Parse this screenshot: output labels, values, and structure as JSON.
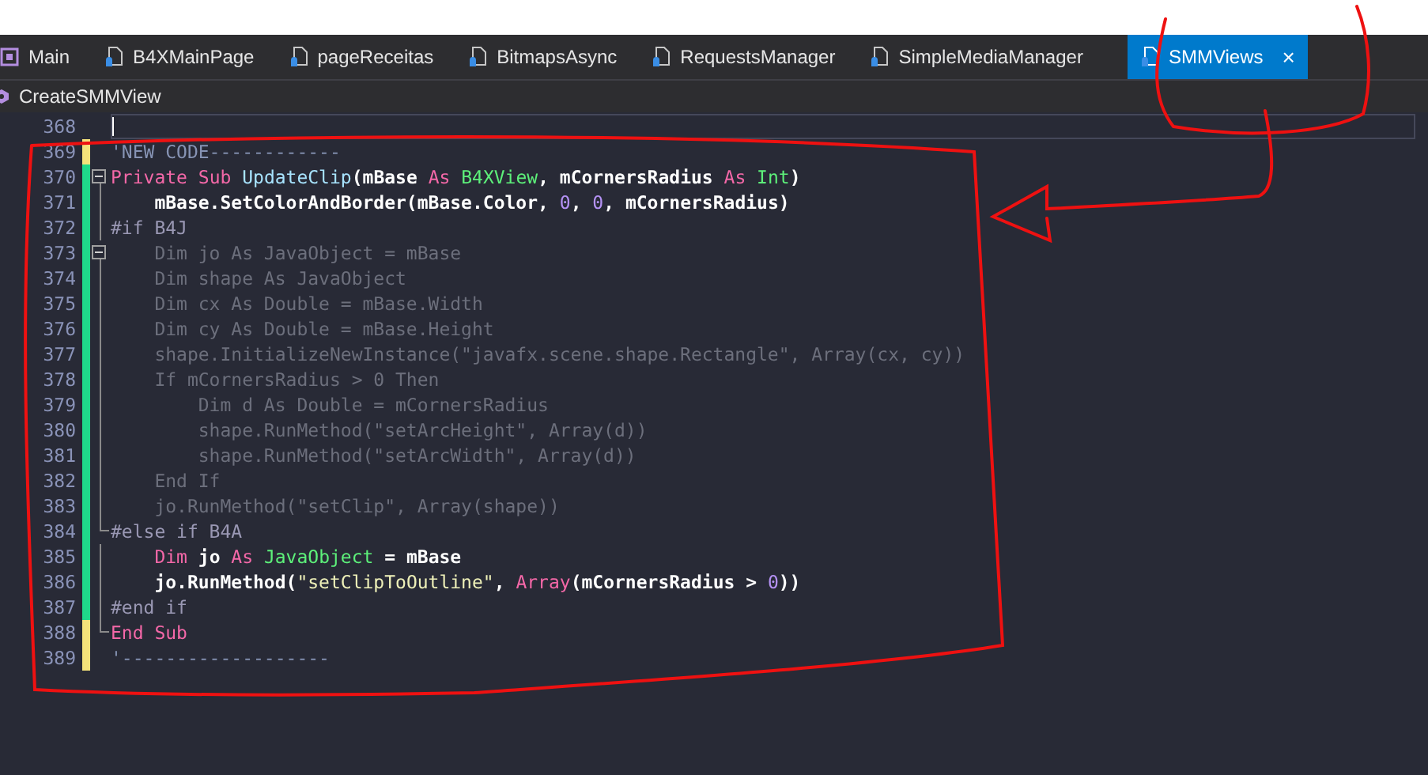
{
  "tabs": [
    {
      "label": "Main",
      "kind": "module",
      "selected": false
    },
    {
      "label": "B4XMainPage",
      "kind": "class",
      "selected": false
    },
    {
      "label": "pageReceitas",
      "kind": "class",
      "selected": false
    },
    {
      "label": "BitmapsAsync",
      "kind": "class",
      "selected": false
    },
    {
      "label": "RequestsManager",
      "kind": "class",
      "selected": false
    },
    {
      "label": "SimpleMediaManager",
      "kind": "class",
      "selected": false
    },
    {
      "label": "SMMViews",
      "kind": "class",
      "selected": true,
      "close": "×"
    }
  ],
  "breadcrumb": {
    "label": "CreateSMMView"
  },
  "lines": [
    {
      "number": "368",
      "kind": "plain",
      "collapsible": false,
      "current": true
    },
    {
      "number": "369",
      "color": "#f4e27a",
      "kind": "plain",
      "collapsible": false,
      "current": false,
      "tokens": [
        {
          "kind": "comment",
          "text": "'NEW CODE------------"
        }
      ]
    },
    {
      "number": "370",
      "color": "#1fd98a",
      "kind": "start",
      "collapsible": true,
      "current": false,
      "tokens": [
        {
          "kind": "keyword",
          "text": "Private"
        },
        {
          "kind": "keyword",
          "text": " Sub"
        },
        {
          "kind": "method",
          "text": " UpdateClip"
        },
        {
          "kind": "ident",
          "text": "(mBase "
        },
        {
          "kind": "keyword",
          "text": "As"
        },
        {
          "kind": "type",
          "text": " B4XView"
        },
        {
          "kind": "ident",
          "text": ", mCornersRadius "
        },
        {
          "kind": "keyword",
          "text": "As"
        },
        {
          "kind": "type",
          "text": " Int"
        },
        {
          "kind": "ident",
          "text": ")"
        }
      ]
    },
    {
      "number": "371",
      "color": "#1fd98a",
      "kind": "inner",
      "collapsible": false,
      "current": false,
      "tokens": [
        {
          "kind": "ident",
          "text": "    mBase.SetColorAndBorder(mBase.Color, "
        },
        {
          "kind": "number",
          "text": "0"
        },
        {
          "kind": "ident",
          "text": ", "
        },
        {
          "kind": "number",
          "text": "0"
        },
        {
          "kind": "ident",
          "text": ", mCornersRadius)"
        }
      ]
    },
    {
      "number": "372",
      "color": "#1fd98a",
      "kind": "inner",
      "collapsible": false,
      "current": false,
      "tokens": [
        {
          "kind": "directive",
          "text": "#if B4J"
        }
      ]
    },
    {
      "number": "373",
      "color": "#1fd98a",
      "kind": "start",
      "collapsible": true,
      "current": false,
      "tokens": [
        {
          "kind": "inactive",
          "text": "    Dim jo As JavaObject = mBase"
        }
      ]
    },
    {
      "number": "374",
      "color": "#1fd98a",
      "kind": "inner",
      "collapsible": false,
      "current": false,
      "tokens": [
        {
          "kind": "inactive",
          "text": "    Dim shape As JavaObject"
        }
      ]
    },
    {
      "number": "375",
      "color": "#1fd98a",
      "kind": "inner",
      "collapsible": false,
      "current": false,
      "tokens": [
        {
          "kind": "inactive",
          "text": "    Dim cx As Double = mBase.Width"
        }
      ]
    },
    {
      "number": "376",
      "color": "#1fd98a",
      "kind": "inner",
      "collapsible": false,
      "current": false,
      "tokens": [
        {
          "kind": "inactive",
          "text": "    Dim cy As Double = mBase.Height"
        }
      ]
    },
    {
      "number": "377",
      "color": "#1fd98a",
      "kind": "inner",
      "collapsible": false,
      "current": false,
      "tokens": [
        {
          "kind": "inactive",
          "text": "    shape.InitializeNewInstance(\"javafx.scene.shape.Rectangle\", Array(cx, cy))"
        }
      ]
    },
    {
      "number": "378",
      "color": "#1fd98a",
      "kind": "inner",
      "collapsible": false,
      "current": false,
      "tokens": [
        {
          "kind": "inactive",
          "text": "    If mCornersRadius > 0 Then"
        }
      ]
    },
    {
      "number": "379",
      "color": "#1fd98a",
      "kind": "inner",
      "collapsible": false,
      "current": false,
      "tokens": [
        {
          "kind": "inactive",
          "text": "        Dim d As Double = mCornersRadius"
        }
      ]
    },
    {
      "number": "380",
      "color": "#1fd98a",
      "kind": "inner",
      "collapsible": false,
      "current": false,
      "tokens": [
        {
          "kind": "inactive",
          "text": "        shape.RunMethod(\"setArcHeight\", Array(d))"
        }
      ]
    },
    {
      "number": "381",
      "color": "#1fd98a",
      "kind": "inner",
      "collapsible": false,
      "current": false,
      "tokens": [
        {
          "kind": "inactive",
          "text": "        shape.RunMethod(\"setArcWidth\", Array(d))"
        }
      ]
    },
    {
      "number": "382",
      "color": "#1fd98a",
      "kind": "inner",
      "collapsible": false,
      "current": false,
      "tokens": [
        {
          "kind": "inactive",
          "text": "    End If"
        }
      ]
    },
    {
      "number": "383",
      "color": "#1fd98a",
      "kind": "inner",
      "collapsible": false,
      "current": false,
      "tokens": [
        {
          "kind": "inactive",
          "text": "    jo.RunMethod(\"setClip\", Array(shape))"
        }
      ]
    },
    {
      "number": "384",
      "color": "#1fd98a",
      "kind": "end",
      "collapsible": false,
      "current": false,
      "tokens": [
        {
          "kind": "directive",
          "text": "#else if B4A"
        }
      ]
    },
    {
      "number": "385",
      "color": "#1fd98a",
      "kind": "inner",
      "collapsible": false,
      "current": false,
      "tokens": [
        {
          "kind": "keyword",
          "text": "    Dim"
        },
        {
          "kind": "ident",
          "text": " jo "
        },
        {
          "kind": "keyword",
          "text": "As"
        },
        {
          "kind": "type",
          "text": " JavaObject"
        },
        {
          "kind": "ident",
          "text": " = mBase"
        }
      ]
    },
    {
      "number": "386",
      "color": "#1fd98a",
      "kind": "inner",
      "collapsible": false,
      "current": false,
      "tokens": [
        {
          "kind": "ident",
          "text": "    jo.RunMethod("
        },
        {
          "kind": "string",
          "text": "\"setClipToOutline\""
        },
        {
          "kind": "ident",
          "text": ", "
        },
        {
          "kind": "keyword",
          "text": "Array"
        },
        {
          "kind": "ident",
          "text": "(mCornersRadius > "
        },
        {
          "kind": "number",
          "text": "0"
        },
        {
          "kind": "ident",
          "text": "))"
        }
      ]
    },
    {
      "number": "387",
      "color": "#1fd98a",
      "kind": "inner",
      "collapsible": false,
      "current": false,
      "tokens": [
        {
          "kind": "directive",
          "text": "#end if"
        }
      ]
    },
    {
      "number": "388",
      "color": "#f4e27a",
      "kind": "end",
      "collapsible": false,
      "current": false,
      "tokens": [
        {
          "kind": "keyword",
          "text": "End Sub"
        }
      ]
    },
    {
      "number": "389",
      "color": "#f4e27a",
      "kind": "plain",
      "collapsible": false,
      "current": false,
      "tokens": [
        {
          "kind": "comment",
          "text": "'-------------------"
        }
      ]
    }
  ]
}
